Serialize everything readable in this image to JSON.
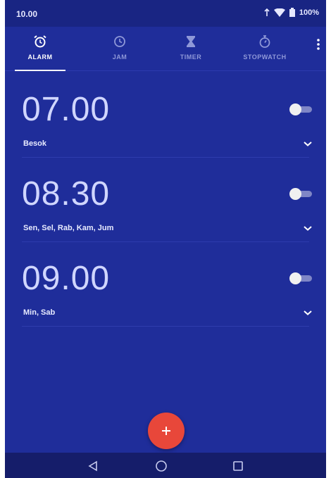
{
  "status_bar": {
    "time": "10.00",
    "battery": "100%"
  },
  "tabs": [
    {
      "label": "ALARM",
      "icon": "alarm-clock-icon",
      "active": true
    },
    {
      "label": "JAM",
      "icon": "clock-icon",
      "active": false
    },
    {
      "label": "TIMER",
      "icon": "hourglass-icon",
      "active": false
    },
    {
      "label": "STOPWATCH",
      "icon": "stopwatch-icon",
      "active": false
    }
  ],
  "alarms": [
    {
      "time": "07.00",
      "days": "Besok",
      "enabled": false
    },
    {
      "time": "08.30",
      "days": "Sen, Sel, Rab, Kam, Jum",
      "enabled": false
    },
    {
      "time": "09.00",
      "days": "Min, Sab",
      "enabled": false
    }
  ],
  "fab": {
    "icon": "plus-icon"
  },
  "colors": {
    "background": "#1f2d9a",
    "status_bar": "#192583",
    "fab": "#e8473a",
    "nav_bar": "#151d6a"
  }
}
